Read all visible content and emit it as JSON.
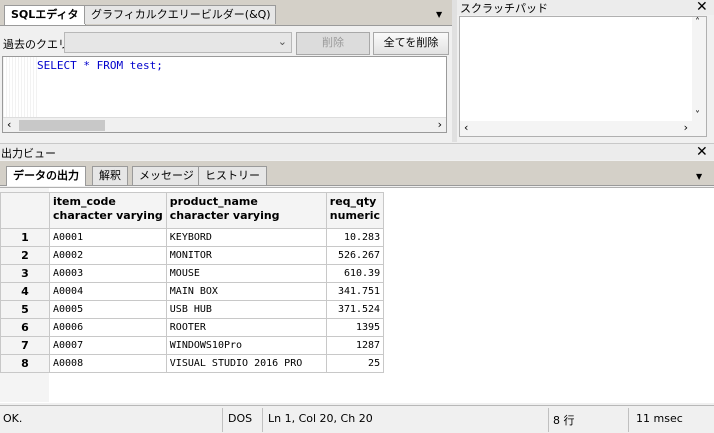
{
  "sql_editor": {
    "tabs": [
      "SQLエディタ",
      "グラフィカルクエリービルダー(&Q)"
    ],
    "past_query_label": "過去のクエリ",
    "delete_button": "削除",
    "delete_all_button": "全てを削除",
    "query_text": "SELECT * FROM test;"
  },
  "scratchpad": {
    "title": "スクラッチパッド"
  },
  "output": {
    "title": "出力ビュー",
    "tabs": [
      "データの出力",
      "解釈",
      "メッセージ",
      "ヒストリー"
    ],
    "columns": [
      {
        "name": "item_code",
        "type": "character varying"
      },
      {
        "name": "product_name",
        "type": "character varying"
      },
      {
        "name": "req_qty",
        "type": "numeric"
      }
    ],
    "rows": [
      {
        "n": "1",
        "item_code": "A0001",
        "product_name": "KEYBORD",
        "req_qty": "10.283"
      },
      {
        "n": "2",
        "item_code": "A0002",
        "product_name": "MONITOR",
        "req_qty": "526.267"
      },
      {
        "n": "3",
        "item_code": "A0003",
        "product_name": "MOUSE",
        "req_qty": "610.39"
      },
      {
        "n": "4",
        "item_code": "A0004",
        "product_name": "MAIN BOX",
        "req_qty": "341.751"
      },
      {
        "n": "5",
        "item_code": "A0005",
        "product_name": "USB HUB",
        "req_qty": "371.524"
      },
      {
        "n": "6",
        "item_code": "A0006",
        "product_name": "ROOTER",
        "req_qty": "1395"
      },
      {
        "n": "7",
        "item_code": "A0007",
        "product_name": "WINDOWS10Pro",
        "req_qty": "1287"
      },
      {
        "n": "8",
        "item_code": "A0008",
        "product_name": "VISUAL STUDIO 2016 PRO",
        "req_qty": "25"
      }
    ]
  },
  "status": {
    "message": "OK.",
    "line_ending": "DOS",
    "position": "Ln 1, Col 20, Ch 20",
    "row_count": "8 行",
    "time": "11 msec"
  },
  "icons": {
    "close": "close-icon",
    "dropdown": "chevron-down-icon",
    "scroll_left": "arrow-left-icon",
    "scroll_right": "arrow-right-icon"
  }
}
